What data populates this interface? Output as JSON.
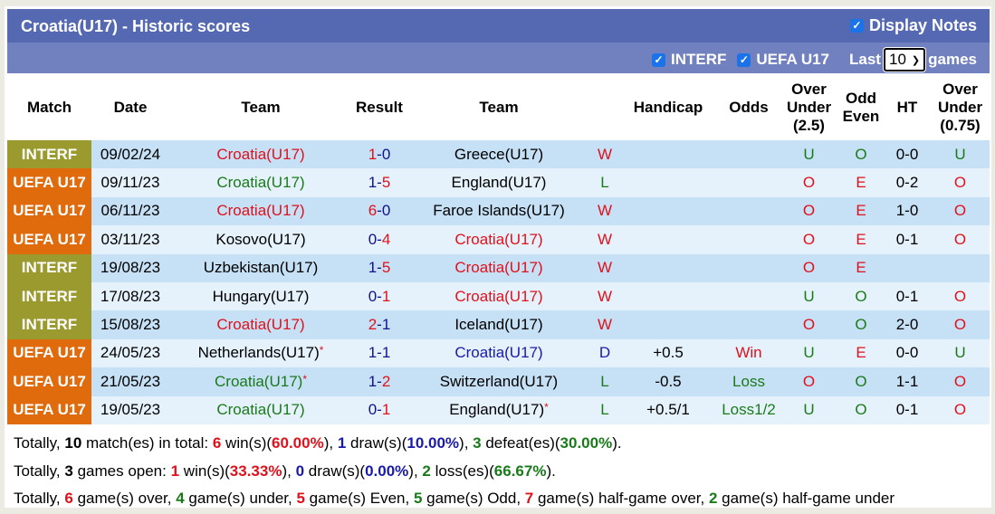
{
  "header": {
    "title": "Croatia(U17) - Historic scores",
    "display_notes_label": "Display Notes",
    "display_notes_checked": true
  },
  "filters": {
    "interf_label": "INTERF",
    "interf_checked": true,
    "uefa_label": "UEFA U17",
    "uefa_checked": true,
    "last_label": "Last",
    "last_value": "10",
    "games_label": "games"
  },
  "colors": {
    "interf": "#9a9a2e",
    "uefa": "#e06b0c",
    "header_bg": "#5569b3",
    "filter_bg": "#7181c0",
    "row_a": "#c6e0f5",
    "row_b": "#e5f2fb",
    "red": "#e0111b",
    "green": "#1a7a1a",
    "blue": "#1a1aa8"
  },
  "columns": [
    "Match",
    "Date",
    "Team",
    "Result",
    "Team",
    "",
    "Handicap",
    "Odds",
    "Over Under (2.5)",
    "Odd Even",
    "HT",
    "Over Under (0.75)"
  ],
  "column_lines": {
    "ou25": [
      "Over",
      "Under",
      "(2.5)"
    ],
    "oe": [
      "Odd",
      "Even"
    ],
    "ou075": [
      "Over",
      "Under",
      "(0.75)"
    ]
  },
  "rows": [
    {
      "match": "INTERF",
      "date": "09/02/24",
      "home": "Croatia(U17)",
      "home_color": "red",
      "home_star": false,
      "score_h": "1",
      "score_h_color": "red",
      "score_a": "0",
      "score_a_color": "navy",
      "away": "Greece(U17)",
      "away_color": "black",
      "away_star": false,
      "wl": "W",
      "wl_color": "red",
      "handicap": "",
      "odds": "",
      "odds_color": "black",
      "ou": "U",
      "ou_color": "green",
      "oe": "O",
      "oe_color": "green",
      "ht": "0-0",
      "ou2": "U",
      "ou2_color": "green"
    },
    {
      "match": "UEFA U17",
      "date": "09/11/23",
      "home": "Croatia(U17)",
      "home_color": "green",
      "home_star": false,
      "score_h": "1",
      "score_h_color": "navy",
      "score_a": "5",
      "score_a_color": "red",
      "away": "England(U17)",
      "away_color": "black",
      "away_star": false,
      "wl": "L",
      "wl_color": "green",
      "handicap": "",
      "odds": "",
      "odds_color": "black",
      "ou": "O",
      "ou_color": "red",
      "oe": "E",
      "oe_color": "red",
      "ht": "0-2",
      "ou2": "O",
      "ou2_color": "red"
    },
    {
      "match": "UEFA U17",
      "date": "06/11/23",
      "home": "Croatia(U17)",
      "home_color": "red",
      "home_star": false,
      "score_h": "6",
      "score_h_color": "red",
      "score_a": "0",
      "score_a_color": "navy",
      "away": "Faroe Islands(U17)",
      "away_color": "black",
      "away_star": false,
      "wl": "W",
      "wl_color": "red",
      "handicap": "",
      "odds": "",
      "odds_color": "black",
      "ou": "O",
      "ou_color": "red",
      "oe": "E",
      "oe_color": "red",
      "ht": "1-0",
      "ou2": "O",
      "ou2_color": "red"
    },
    {
      "match": "UEFA U17",
      "date": "03/11/23",
      "home": "Kosovo(U17)",
      "home_color": "black",
      "home_star": false,
      "score_h": "0",
      "score_h_color": "navy",
      "score_a": "4",
      "score_a_color": "red",
      "away": "Croatia(U17)",
      "away_color": "red",
      "away_star": false,
      "wl": "W",
      "wl_color": "red",
      "handicap": "",
      "odds": "",
      "odds_color": "black",
      "ou": "O",
      "ou_color": "red",
      "oe": "E",
      "oe_color": "red",
      "ht": "0-1",
      "ou2": "O",
      "ou2_color": "red"
    },
    {
      "match": "INTERF",
      "date": "19/08/23",
      "home": "Uzbekistan(U17)",
      "home_color": "black",
      "home_star": false,
      "score_h": "1",
      "score_h_color": "navy",
      "score_a": "5",
      "score_a_color": "red",
      "away": "Croatia(U17)",
      "away_color": "red",
      "away_star": false,
      "wl": "W",
      "wl_color": "red",
      "handicap": "",
      "odds": "",
      "odds_color": "black",
      "ou": "O",
      "ou_color": "red",
      "oe": "E",
      "oe_color": "red",
      "ht": "",
      "ou2": "",
      "ou2_color": "black"
    },
    {
      "match": "INTERF",
      "date": "17/08/23",
      "home": "Hungary(U17)",
      "home_color": "black",
      "home_star": false,
      "score_h": "0",
      "score_h_color": "navy",
      "score_a": "1",
      "score_a_color": "red",
      "away": "Croatia(U17)",
      "away_color": "red",
      "away_star": false,
      "wl": "W",
      "wl_color": "red",
      "handicap": "",
      "odds": "",
      "odds_color": "black",
      "ou": "U",
      "ou_color": "green",
      "oe": "O",
      "oe_color": "green",
      "ht": "0-1",
      "ou2": "O",
      "ou2_color": "red"
    },
    {
      "match": "INTERF",
      "date": "15/08/23",
      "home": "Croatia(U17)",
      "home_color": "red",
      "home_star": false,
      "score_h": "2",
      "score_h_color": "red",
      "score_a": "1",
      "score_a_color": "navy",
      "away": "Iceland(U17)",
      "away_color": "black",
      "away_star": false,
      "wl": "W",
      "wl_color": "red",
      "handicap": "",
      "odds": "",
      "odds_color": "black",
      "ou": "O",
      "ou_color": "red",
      "oe": "O",
      "oe_color": "green",
      "ht": "2-0",
      "ou2": "O",
      "ou2_color": "red"
    },
    {
      "match": "UEFA U17",
      "date": "24/05/23",
      "home": "Netherlands(U17)",
      "home_color": "black",
      "home_star": true,
      "score_h": "1",
      "score_h_color": "navy",
      "score_a": "1",
      "score_a_color": "navy",
      "away": "Croatia(U17)",
      "away_color": "blue",
      "away_star": false,
      "wl": "D",
      "wl_color": "blue",
      "handicap": "+0.5",
      "odds": "Win",
      "odds_color": "red",
      "ou": "U",
      "ou_color": "green",
      "oe": "E",
      "oe_color": "red",
      "ht": "0-0",
      "ou2": "U",
      "ou2_color": "green"
    },
    {
      "match": "UEFA U17",
      "date": "21/05/23",
      "home": "Croatia(U17)",
      "home_color": "green",
      "home_star": true,
      "score_h": "1",
      "score_h_color": "navy",
      "score_a": "2",
      "score_a_color": "red",
      "away": "Switzerland(U17)",
      "away_color": "black",
      "away_star": false,
      "wl": "L",
      "wl_color": "green",
      "handicap": "-0.5",
      "odds": "Loss",
      "odds_color": "green",
      "ou": "O",
      "ou_color": "red",
      "oe": "O",
      "oe_color": "green",
      "ht": "1-1",
      "ou2": "O",
      "ou2_color": "red"
    },
    {
      "match": "UEFA U17",
      "date": "19/05/23",
      "home": "Croatia(U17)",
      "home_color": "green",
      "home_star": false,
      "score_h": "0",
      "score_h_color": "navy",
      "score_a": "1",
      "score_a_color": "red",
      "away": "England(U17)",
      "away_color": "black",
      "away_star": true,
      "wl": "L",
      "wl_color": "green",
      "handicap": "+0.5/1",
      "odds": "Loss1/2",
      "odds_color": "green",
      "ou": "U",
      "ou_color": "green",
      "oe": "O",
      "oe_color": "green",
      "ht": "0-1",
      "ou2": "O",
      "ou2_color": "red"
    }
  ],
  "summary": [
    [
      {
        "t": "Totally, ",
        "c": ""
      },
      {
        "t": "10",
        "c": "black",
        "b": true
      },
      {
        "t": " match(es) in total: ",
        "c": ""
      },
      {
        "t": "6",
        "c": "red",
        "b": true
      },
      {
        "t": " win(s)(",
        "c": ""
      },
      {
        "t": "60.00%",
        "c": "red",
        "b": true
      },
      {
        "t": "), ",
        "c": ""
      },
      {
        "t": "1",
        "c": "blue",
        "b": true
      },
      {
        "t": " draw(s)(",
        "c": ""
      },
      {
        "t": "10.00%",
        "c": "blue",
        "b": true
      },
      {
        "t": "), ",
        "c": ""
      },
      {
        "t": "3",
        "c": "green",
        "b": true
      },
      {
        "t": " defeat(es)(",
        "c": ""
      },
      {
        "t": "30.00%",
        "c": "green",
        "b": true
      },
      {
        "t": ").",
        "c": ""
      }
    ],
    [
      {
        "t": "Totally, ",
        "c": ""
      },
      {
        "t": "3",
        "c": "black",
        "b": true
      },
      {
        "t": " games open: ",
        "c": ""
      },
      {
        "t": "1",
        "c": "red",
        "b": true
      },
      {
        "t": " win(s)(",
        "c": ""
      },
      {
        "t": "33.33%",
        "c": "red",
        "b": true
      },
      {
        "t": "), ",
        "c": ""
      },
      {
        "t": "0",
        "c": "blue",
        "b": true
      },
      {
        "t": " draw(s)(",
        "c": ""
      },
      {
        "t": "0.00%",
        "c": "blue",
        "b": true
      },
      {
        "t": "), ",
        "c": ""
      },
      {
        "t": "2",
        "c": "green",
        "b": true
      },
      {
        "t": " loss(es)(",
        "c": ""
      },
      {
        "t": "66.67%",
        "c": "green",
        "b": true
      },
      {
        "t": ").",
        "c": ""
      }
    ],
    [
      {
        "t": "Totally, ",
        "c": ""
      },
      {
        "t": "6",
        "c": "red",
        "b": true
      },
      {
        "t": " game(s) over, ",
        "c": ""
      },
      {
        "t": "4",
        "c": "green",
        "b": true
      },
      {
        "t": " game(s) under, ",
        "c": ""
      },
      {
        "t": "5",
        "c": "red",
        "b": true
      },
      {
        "t": " game(s) Even, ",
        "c": ""
      },
      {
        "t": "5",
        "c": "green",
        "b": true
      },
      {
        "t": " game(s) Odd, ",
        "c": ""
      },
      {
        "t": "7",
        "c": "red",
        "b": true
      },
      {
        "t": " game(s) half-game over, ",
        "c": ""
      },
      {
        "t": "2",
        "c": "green",
        "b": true
      },
      {
        "t": " game(s) half-game under",
        "c": ""
      }
    ]
  ]
}
